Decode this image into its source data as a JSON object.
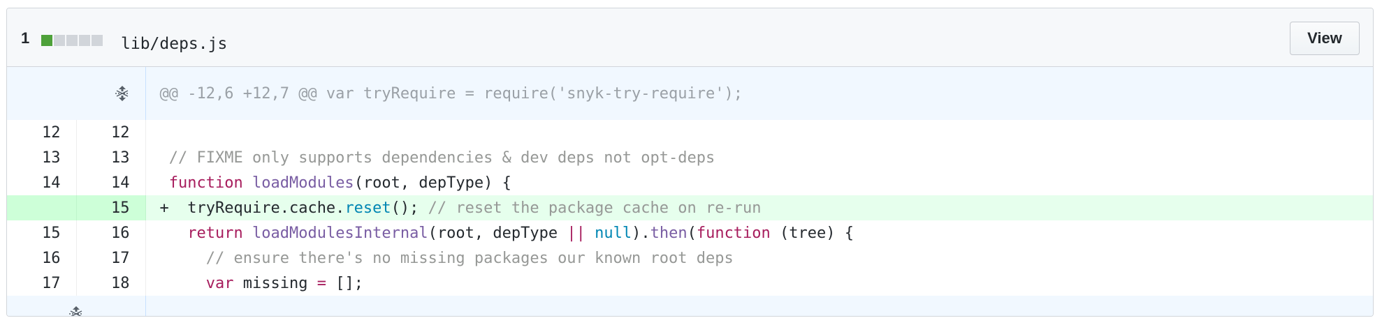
{
  "file": {
    "diffstat_count": "1",
    "diffstat_blocks": [
      "add",
      "neutral",
      "neutral",
      "neutral",
      "neutral"
    ],
    "name": "lib/deps.js",
    "view_label": "View"
  },
  "hunk": {
    "header": "@@ -12,6 +12,7 @@ var tryRequire = require('snyk-try-require');"
  },
  "lines": [
    {
      "old": "12",
      "new": "12",
      "prefix": " ",
      "tokens": []
    },
    {
      "old": "13",
      "new": "13",
      "prefix": " ",
      "tokens": [
        {
          "t": "// FIXME only supports dependencies & dev deps not opt-deps",
          "c": "comment"
        }
      ]
    },
    {
      "old": "14",
      "new": "14",
      "prefix": " ",
      "tokens": [
        {
          "t": "function",
          "c": "key"
        },
        {
          "t": " ",
          "c": ""
        },
        {
          "t": "loadModules",
          "c": "fn"
        },
        {
          "t": "(root, depType) {",
          "c": ""
        }
      ]
    },
    {
      "old": "",
      "new": "15",
      "prefix": "+",
      "type": "add",
      "tokens": [
        {
          "t": "  tryRequire.cache.",
          "c": ""
        },
        {
          "t": "reset",
          "c": "const"
        },
        {
          "t": "(); ",
          "c": ""
        },
        {
          "t": "// reset the package cache on re-run",
          "c": "comment"
        }
      ]
    },
    {
      "old": "15",
      "new": "16",
      "prefix": " ",
      "tokens": [
        {
          "t": "  ",
          "c": ""
        },
        {
          "t": "return",
          "c": "key"
        },
        {
          "t": " ",
          "c": ""
        },
        {
          "t": "loadModulesInternal",
          "c": "fn"
        },
        {
          "t": "(root, depType ",
          "c": ""
        },
        {
          "t": "||",
          "c": "key"
        },
        {
          "t": " ",
          "c": ""
        },
        {
          "t": "null",
          "c": "const"
        },
        {
          "t": ").",
          "c": ""
        },
        {
          "t": "then",
          "c": "fn"
        },
        {
          "t": "(",
          "c": ""
        },
        {
          "t": "function",
          "c": "key"
        },
        {
          "t": " (tree) {",
          "c": ""
        }
      ]
    },
    {
      "old": "16",
      "new": "17",
      "prefix": " ",
      "tokens": [
        {
          "t": "    ",
          "c": ""
        },
        {
          "t": "// ensure there's no missing packages our known root deps",
          "c": "comment"
        }
      ]
    },
    {
      "old": "17",
      "new": "18",
      "prefix": " ",
      "tokens": [
        {
          "t": "    ",
          "c": ""
        },
        {
          "t": "var",
          "c": "key"
        },
        {
          "t": " missing ",
          "c": ""
        },
        {
          "t": "=",
          "c": "key"
        },
        {
          "t": " [];",
          "c": ""
        }
      ]
    }
  ],
  "icons": {
    "expand_up": "unfold-icon",
    "expand_down": "unfold-icon"
  },
  "colors": {
    "add_bg": "#e6ffed",
    "add_num_bg": "#cdffd8",
    "hunk_bg": "#f1f8ff",
    "keyword": "#a71d5d",
    "function": "#795da3",
    "constant": "#0086b3",
    "comment": "#969896"
  }
}
